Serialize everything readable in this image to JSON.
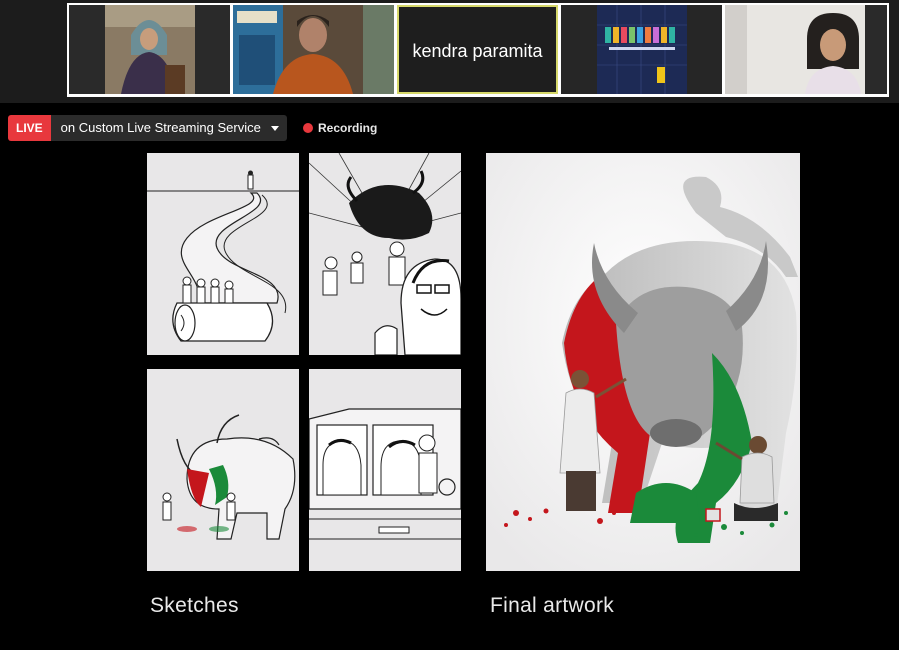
{
  "participants": [
    {
      "name": "",
      "type": "video"
    },
    {
      "name": "",
      "type": "video"
    },
    {
      "name": "kendra paramita",
      "type": "name-only",
      "active_speaker": true
    },
    {
      "name": "",
      "type": "screen"
    },
    {
      "name": "",
      "type": "video"
    }
  ],
  "live": {
    "badge": "LIVE",
    "service": "on Custom Live Streaming Service",
    "recording": "Recording"
  },
  "slide": {
    "sketches_caption": "Sketches",
    "final_caption": "Final artwork"
  },
  "colors": {
    "live_red": "#e8383d",
    "speaker_outline": "#d6d86a",
    "bull_red": "#c4161c",
    "bull_green": "#1b8a3a"
  }
}
